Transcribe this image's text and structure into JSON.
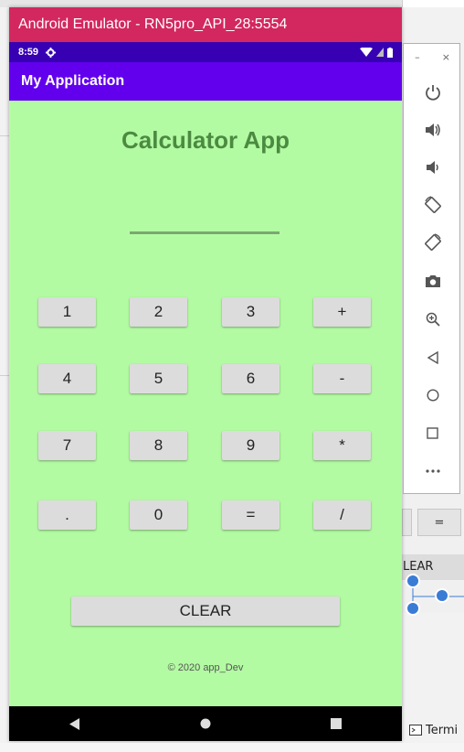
{
  "window": {
    "title": "Android Emulator - RN5pro_API_28:5554"
  },
  "status_bar": {
    "time": "8:59"
  },
  "app_bar": {
    "title": "My Application"
  },
  "calculator": {
    "title": "Calculator App",
    "display_value": "",
    "rows": [
      [
        "1",
        "2",
        "3",
        "+"
      ],
      [
        "4",
        "5",
        "6",
        "-"
      ],
      [
        "7",
        "8",
        "9",
        "*"
      ],
      [
        ".",
        "0",
        "=",
        "/"
      ]
    ],
    "clear_label": "CLEAR",
    "copyright": "© 2020 app_Dev"
  },
  "side_toolbar": {
    "minimize": "–",
    "close": "×",
    "tools": [
      "power-icon",
      "volume-up-icon",
      "volume-down-icon",
      "rotate-left-icon",
      "rotate-right-icon",
      "camera-icon",
      "zoom-icon",
      "back-icon",
      "home-icon",
      "overview-icon",
      "more-icon"
    ]
  },
  "background": {
    "eq_label": "=",
    "clear_fragment": "LEAR",
    "terminal_label": "Termi"
  },
  "colors": {
    "title_bar": "#d3275f",
    "status_bar": "#3700b3",
    "app_bar": "#6200ee",
    "content_bg": "#b3fba3",
    "title_text": "#4c8a41"
  }
}
